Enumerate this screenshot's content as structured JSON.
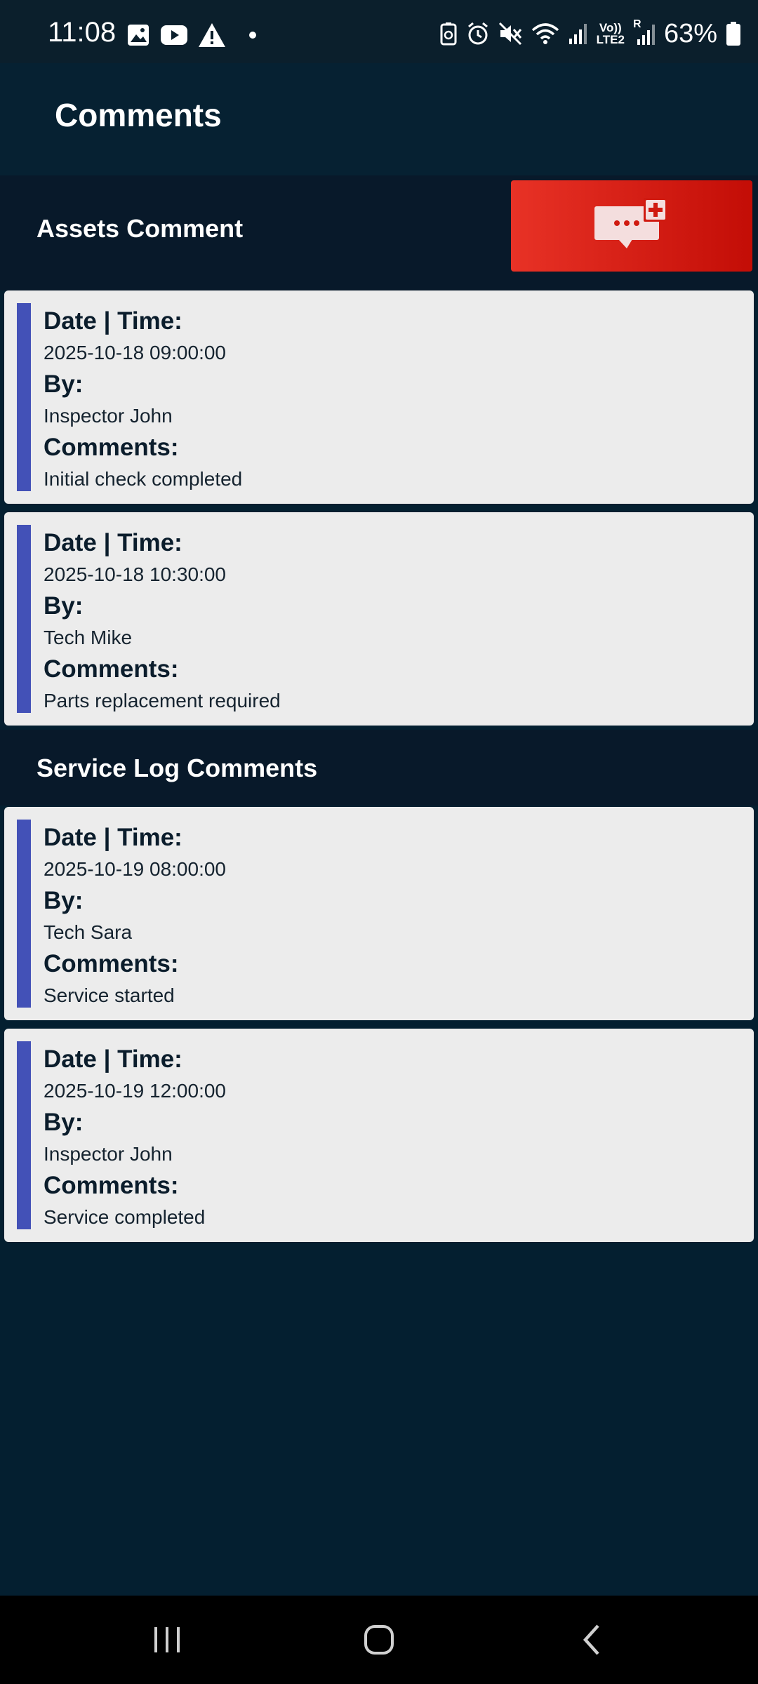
{
  "status_bar": {
    "time": "11:08",
    "battery": "63%",
    "left_icons": [
      "gallery-icon",
      "youtube-icon",
      "warning-icon",
      "dot-icon"
    ],
    "right_icons": [
      "battery-saver-icon",
      "alarm-icon",
      "mute-icon",
      "wifi-icon",
      "signal-icon",
      "volte-icon",
      "signal-roaming-icon",
      "battery-icon"
    ],
    "volte_label": "Vo))",
    "lte_label": "LTE2",
    "roaming_label": "R"
  },
  "app_bar": {
    "title": "Comments"
  },
  "assets_section": {
    "title": "Assets Comment",
    "add_button_icon": "add-comment-icon"
  },
  "labels": {
    "date_time": "Date | Time:",
    "by": "By:",
    "comments": "Comments:"
  },
  "assets_comments": [
    {
      "datetime": "2025-10-18 09:00:00",
      "by": "Inspector John",
      "comment": "Initial check completed"
    },
    {
      "datetime": "2025-10-18 10:30:00",
      "by": "Tech Mike",
      "comment": "Parts replacement required"
    }
  ],
  "service_section": {
    "title": "Service Log Comments"
  },
  "service_comments": [
    {
      "datetime": "2025-10-19 08:00:00",
      "by": "Tech Sara",
      "comment": "Service started"
    },
    {
      "datetime": "2025-10-19 12:00:00",
      "by": "Inspector John",
      "comment": "Service completed"
    }
  ],
  "nav_bar": {
    "buttons": [
      "recents-icon",
      "home-icon",
      "back-icon"
    ]
  },
  "colors": {
    "background": "#041f30",
    "accent": "#4351b7",
    "add_button": "#d51f15",
    "card": "#ececec"
  }
}
